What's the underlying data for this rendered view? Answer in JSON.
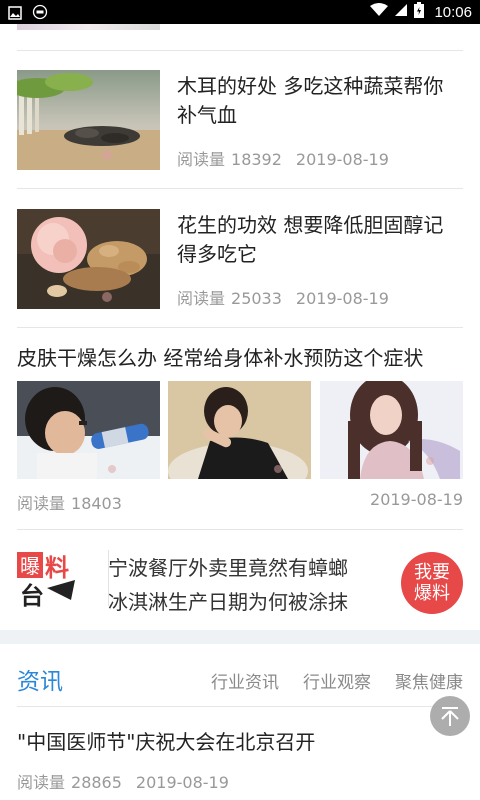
{
  "status_bar": {
    "time": "10:06"
  },
  "articles": [
    {
      "title": "木耳的好处 多吃这种蔬菜帮你补气血",
      "views_label": "阅读量",
      "views": "18392",
      "date": "2019-08-19"
    },
    {
      "title": "花生的功效 想要降低胆固醇记得多吃它",
      "views_label": "阅读量",
      "views": "25033",
      "date": "2019-08-19"
    }
  ],
  "gallery_article": {
    "title": "皮肤干燥怎么办 经常给身体补水预防这个症状",
    "views_label": "阅读量",
    "views": "18403",
    "date": "2019-08-19"
  },
  "baoliao": {
    "logo_text_top": "曝",
    "logo_text_mid": "料",
    "logo_text_bottom": "台",
    "line1": "宁波餐厅外卖里竟然有蟑螂",
    "line2": "冰淇淋生产日期为何被涂抹",
    "button_line1": "我要",
    "button_line2": "爆料"
  },
  "news_section": {
    "title": "资讯",
    "tabs": [
      "行业资讯",
      "行业观察",
      "聚焦健康"
    ],
    "first_item": {
      "title": "\"中国医师节\"庆祝大会在北京召开",
      "views_label": "阅读量",
      "views": "28865",
      "date": "2019-08-19"
    }
  },
  "colors": {
    "accent": "#2d87d8",
    "baoliao_red": "#e74848"
  }
}
